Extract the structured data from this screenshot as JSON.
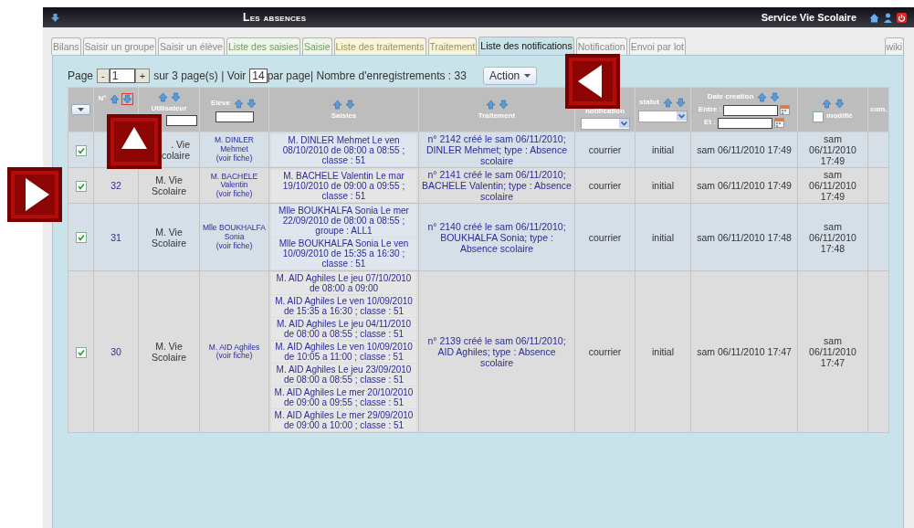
{
  "window": {
    "title": "Les absences",
    "user": "Service Vie Scolaire"
  },
  "tabs": [
    {
      "label": "Bilans",
      "kind": "general",
      "selected": false
    },
    {
      "label": "Saisir un groupe",
      "kind": "general",
      "selected": false
    },
    {
      "label": "Saisir un élève",
      "kind": "general",
      "selected": false
    },
    {
      "label": "Liste des saisies",
      "kind": "saisie",
      "selected": false
    },
    {
      "label": "Saisie",
      "kind": "saisie",
      "selected": false
    },
    {
      "label": "Liste des traitements",
      "kind": "traitement",
      "selected": false
    },
    {
      "label": "Traitement",
      "kind": "traitement",
      "selected": false
    },
    {
      "label": "Liste des notifications",
      "kind": "notification",
      "selected": true
    },
    {
      "label": "Notification",
      "kind": "general",
      "selected": false
    },
    {
      "label": "Envoi par lot",
      "kind": "general",
      "selected": false
    }
  ],
  "wiki": "wiki",
  "pager": {
    "page_label": "Page",
    "minus": "-",
    "page": "1",
    "plus": "+",
    "pages_text": "sur 3 page(s) | Voir",
    "per_page": "14",
    "count_text": "par page| Nombre d'enregistrements : 33",
    "action": "Action"
  },
  "header": {
    "num_label": "N°",
    "num_sort_down_selected": true,
    "user_label": "Utilisateur",
    "eleve_label": "Eleve",
    "saisies_label": "Saisies",
    "traitement_label": "Traitement",
    "type_label": "notification",
    "statut_label": "statut",
    "date_label": "Date creation",
    "date_from": "Entre :",
    "date_to": "Et :",
    "modif_label": "modifié",
    "modif_checked": false,
    "com_label": "com."
  },
  "rows": [
    {
      "checked": true,
      "user": ". Vie colaire",
      "eleve": "M. DINLER Mehmet",
      "eleve_link": "(voir fiche)",
      "saisies": [
        "M. DINLER Mehmet Le ven 08/10/2010 de 08:00 a 08:55 ; classe : 51"
      ],
      "traitement": "n° 2142 créé le sam 06/11/2010; DINLER Mehmet; type : Absence scolaire",
      "type": "courrier",
      "statut": "initial",
      "date": "sam 06/11/2010 17:49",
      "modif": "sam 06/11/2010 17:49"
    },
    {
      "checked": true,
      "num": "32",
      "user": "M. Vie Scolaire",
      "eleve": "M. BACHELE Valentin",
      "eleve_link": "(voir fiche)",
      "saisies": [
        "M. BACHELE Valentin Le mar 19/10/2010 de 09:00 a 09:55 ; classe : 51"
      ],
      "traitement": "n° 2141 créé le sam 06/11/2010; BACHELE Valentin; type : Absence scolaire",
      "type": "courrier",
      "statut": "initial",
      "date": "sam 06/11/2010 17:49",
      "modif": "sam 06/11/2010 17:49"
    },
    {
      "checked": true,
      "num": "31",
      "user": "M. Vie Scolaire",
      "eleve": "Mlle BOUKHALFA Sonia",
      "eleve_link": "(voir fiche)",
      "saisies": [
        "Mlle BOUKHALFA Sonia Le mer 22/09/2010 de 08:00 a 08:55 ; groupe : ALL1",
        "Mlle BOUKHALFA Sonia Le ven 10/09/2010 de 15:35 a 16:30 ; classe : 51"
      ],
      "traitement": "n° 2140 créé le sam 06/11/2010; BOUKHALFA Sonia; type : Absence scolaire",
      "type": "courrier",
      "statut": "initial",
      "date": "sam 06/11/2010 17:48",
      "modif": "sam 06/11/2010 17:48"
    },
    {
      "checked": true,
      "num": "30",
      "user": "M. Vie Scolaire",
      "eleve": "M. AID Aghiles",
      "eleve_link": "(voir fiche)",
      "saisies": [
        "M. AID Aghiles Le jeu 07/10/2010 de 08:00 a 09:00",
        "M. AID Aghiles Le ven 10/09/2010 de 15:35 a 16:30 ; classe : 51",
        "M. AID Aghiles Le jeu 04/11/2010 de 08:00 a 08:55 ; classe : 51",
        "M. AID Aghiles Le ven 10/09/2010 de 10:05 a 11:00 ; classe : 51",
        "M. AID Aghiles Le jeu 23/09/2010 de 08:00 a 08:55 ; classe : 51",
        "M. AID Aghiles Le mer 20/10/2010 de 09:00 a 09:55 ; classe : 51",
        "M. AID Aghiles Le mer 29/09/2010 de 09:00 a 10:00 ; classe : 51"
      ],
      "traitement": "n° 2139 créé le sam 06/11/2010; AID Aghiles; type : Absence scolaire",
      "type": "courrier",
      "statut": "initial",
      "date": "sam 06/11/2010 17:47",
      "modif": "sam 06/11/2010 17:47"
    }
  ]
}
